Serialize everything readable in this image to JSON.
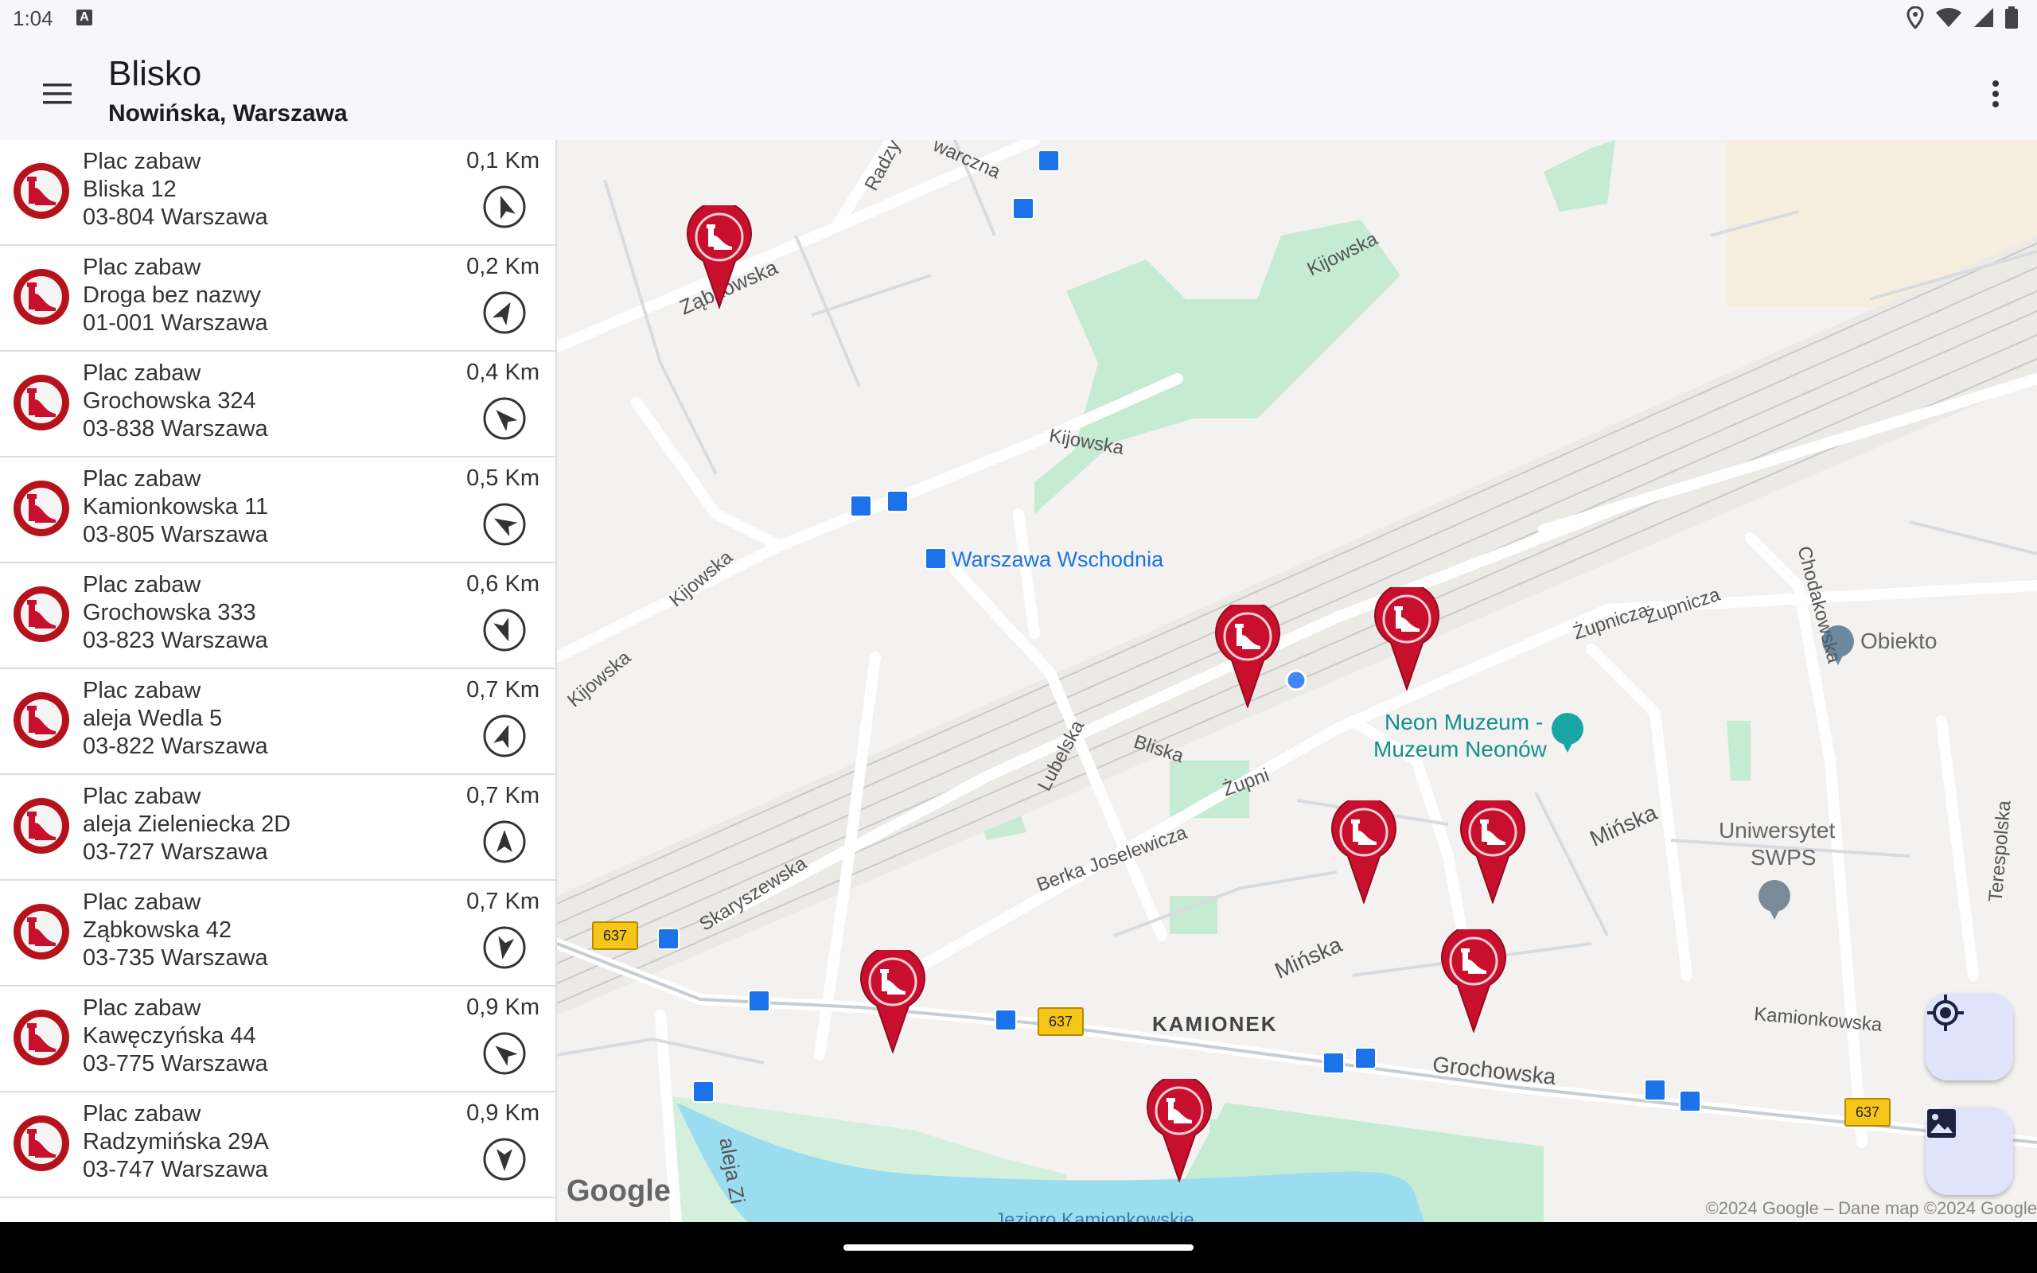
{
  "status": {
    "time": "1:04",
    "a_icon": "A"
  },
  "appbar": {
    "title": "Blisko",
    "subtitle": "Nowińska, Warszawa"
  },
  "list": [
    {
      "category": "Plac zabaw",
      "street": "Bliska 12",
      "city": "03-804 Warszawa",
      "distance": "0,1 Km"
    },
    {
      "category": "Plac zabaw",
      "street": "Droga bez nazwy",
      "city": "01-001 Warszawa",
      "distance": "0,2 Km"
    },
    {
      "category": "Plac zabaw",
      "street": "Grochowska 324",
      "city": "03-838 Warszawa",
      "distance": "0,4 Km"
    },
    {
      "category": "Plac zabaw",
      "street": "Kamionkowska 11",
      "city": "03-805 Warszawa",
      "distance": "0,5 Km"
    },
    {
      "category": "Plac zabaw",
      "street": "Grochowska 333",
      "city": "03-823 Warszawa",
      "distance": "0,6 Km"
    },
    {
      "category": "Plac zabaw",
      "street": "aleja Wedla 5",
      "city": "03-822 Warszawa",
      "distance": "0,7 Km"
    },
    {
      "category": "Plac zabaw",
      "street": "aleja Zieleniecka 2D",
      "city": "03-727 Warszawa",
      "distance": "0,7 Km"
    },
    {
      "category": "Plac zabaw",
      "street": "Ząbkowska 42",
      "city": "03-735 Warszawa",
      "distance": "0,7 Km"
    },
    {
      "category": "Plac zabaw",
      "street": "Kawęczyńska 44",
      "city": "03-775 Warszawa",
      "distance": "0,9 Km"
    },
    {
      "category": "Plac zabaw",
      "street": "Radzymińska 29A",
      "city": "03-747 Warszawa",
      "distance": "0,9 Km"
    }
  ],
  "map": {
    "labels": {
      "zabkowska": "Ząbkowska",
      "radzyminska": "Radzy",
      "kawczynska": "warczna",
      "kijowska1": "Kijowska",
      "kijowska2": "Kijowska",
      "kijowska3": "Kijowska",
      "kijowska4": "Kijowska",
      "station": "Warszawa Wschodnia",
      "zupnicza1": "Żupnicza",
      "zupnicza2": "Żupnicza",
      "zupnicza3": "Żupni",
      "chodakowska": "Chodakowska",
      "obiekto": "Obiekto",
      "museum1": "Neon Muzeum -",
      "museum2": "Muzeum Neonów",
      "bliska": "Bliska",
      "lubelska": "Lubelska",
      "minska1": "Mińska",
      "minska2": "Mińska",
      "university1": "Uniwersytet",
      "university2": "SWPS",
      "terespolska": "Terespolska",
      "skaryszewska": "Skaryszewska",
      "berka": "Berka Joselewicza",
      "kamionek": "KAMIONEK",
      "kamionkowska": "Kamionkowska",
      "grochowska": "Grochowska",
      "aleja": "aleja Zi",
      "lake": "Jezioro Kamionkowskie",
      "road637": "637"
    },
    "google": "Google",
    "copyright": "©2024 Google – Dane map ©2024 Google"
  },
  "colors": {
    "marker_red": "#c8102e",
    "accent": "#1a73e8",
    "water": "#9adcf0",
    "park": "#c6ebd3"
  }
}
